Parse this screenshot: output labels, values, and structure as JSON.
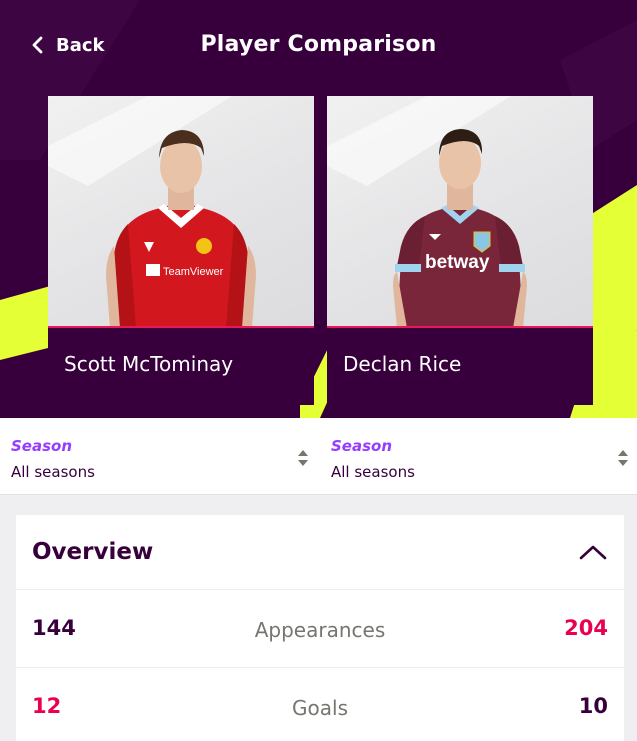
{
  "header": {
    "back_label": "Back",
    "title": "Player Comparison",
    "icons": {
      "back": "chevron-left-icon"
    }
  },
  "players": [
    {
      "name": "Scott McTominay",
      "kit_sponsor": "TeamViewer",
      "kit_color": "#d3171e"
    },
    {
      "name": "Declan Rice",
      "kit_sponsor": "betway",
      "kit_color": "#7a263a"
    }
  ],
  "season_selectors": [
    {
      "label": "Season",
      "value": "All seasons"
    },
    {
      "label": "Season",
      "value": "All seasons"
    }
  ],
  "overview": {
    "title": "Overview",
    "icons": {
      "toggle": "chevron-up-icon",
      "select": "sort-arrows-icon"
    },
    "rows": [
      {
        "stat": "Appearances",
        "left": "144",
        "right": "204",
        "leader": "right"
      },
      {
        "stat": "Goals",
        "left": "12",
        "right": "10",
        "leader": "left"
      }
    ]
  },
  "colors": {
    "brand_purple": "#37003c",
    "highlight_pink": "#e90052",
    "accent_lime": "#e5ff37",
    "season_purple": "#963cff"
  }
}
